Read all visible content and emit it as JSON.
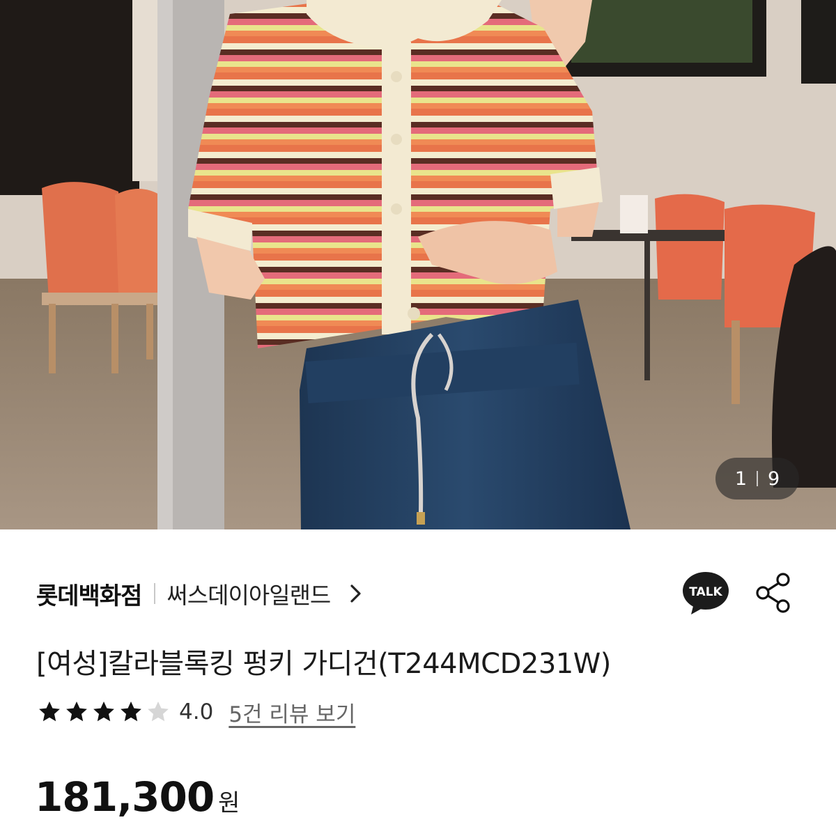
{
  "gallery": {
    "current": "1",
    "total": "9"
  },
  "store": {
    "name": "롯데백화점",
    "shop": "써스데이아일랜드"
  },
  "actions": {
    "talk_label": "TALK"
  },
  "product": {
    "title": "[여성]칼라블록킹 펑키 가디건(T244MCD231W)",
    "rating": "4.0",
    "rating_value": 4,
    "rating_max": 5,
    "review_link": "5건 리뷰 보기",
    "price": "181,300",
    "currency": "원"
  },
  "colors": {
    "kakao_icon": "#1b1b1b",
    "star_filled": "#111111",
    "star_empty": "#d6d6d6"
  }
}
